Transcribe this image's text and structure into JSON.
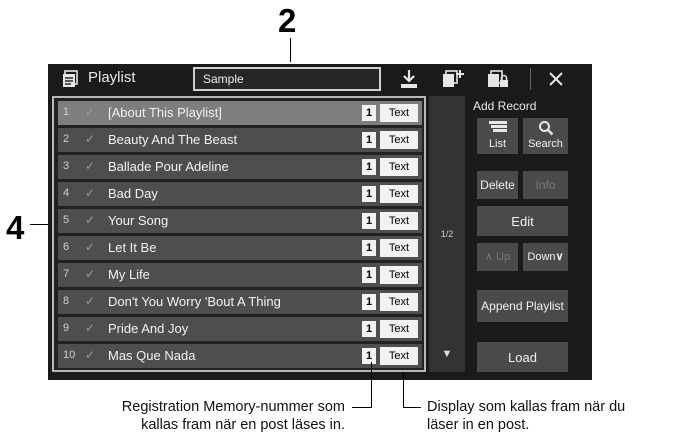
{
  "annotations": {
    "callout_2": "2",
    "callout_4": "4",
    "caption_left": [
      "Registration Memory-nummer som",
      "kallas fram när en post läses in."
    ],
    "caption_right": [
      "Display som kallas fram när du",
      "läser in en post."
    ]
  },
  "header": {
    "title": "Playlist",
    "playlist_name": "Sample"
  },
  "playlist": {
    "items": [
      {
        "num": "1",
        "title": "[About This Playlist]",
        "memory": "1",
        "display": "Text"
      },
      {
        "num": "2",
        "title": "Beauty And The Beast",
        "memory": "1",
        "display": "Text"
      },
      {
        "num": "3",
        "title": "Ballade Pour Adeline",
        "memory": "1",
        "display": "Text"
      },
      {
        "num": "4",
        "title": "Bad Day",
        "memory": "1",
        "display": "Text"
      },
      {
        "num": "5",
        "title": "Your Song",
        "memory": "1",
        "display": "Text"
      },
      {
        "num": "6",
        "title": "Let It Be",
        "memory": "1",
        "display": "Text"
      },
      {
        "num": "7",
        "title": "My Life",
        "memory": "1",
        "display": "Text"
      },
      {
        "num": "8",
        "title": "Don't You Worry 'Bout A Thing",
        "memory": "1",
        "display": "Text"
      },
      {
        "num": "9",
        "title": "Pride And Joy",
        "memory": "1",
        "display": "Text"
      },
      {
        "num": "10",
        "title": "Mas Que Nada",
        "memory": "1",
        "display": "Text"
      }
    ],
    "page_indicator": "1/2"
  },
  "panel": {
    "add_record": "Add Record",
    "list": "List",
    "search": "Search",
    "delete": "Delete",
    "info": "Info",
    "edit": "Edit",
    "up": "Up",
    "down": "Down",
    "append_playlist": "Append Playlist",
    "load": "Load"
  },
  "icons": {
    "playlist": "playlist-icon",
    "save": "save-download-icon",
    "new": "new-playlist-icon",
    "file": "file-lock-icon",
    "close": "close-icon",
    "list": "list-icon",
    "search": "search-icon",
    "scroll_down": "triangle-down-icon"
  }
}
